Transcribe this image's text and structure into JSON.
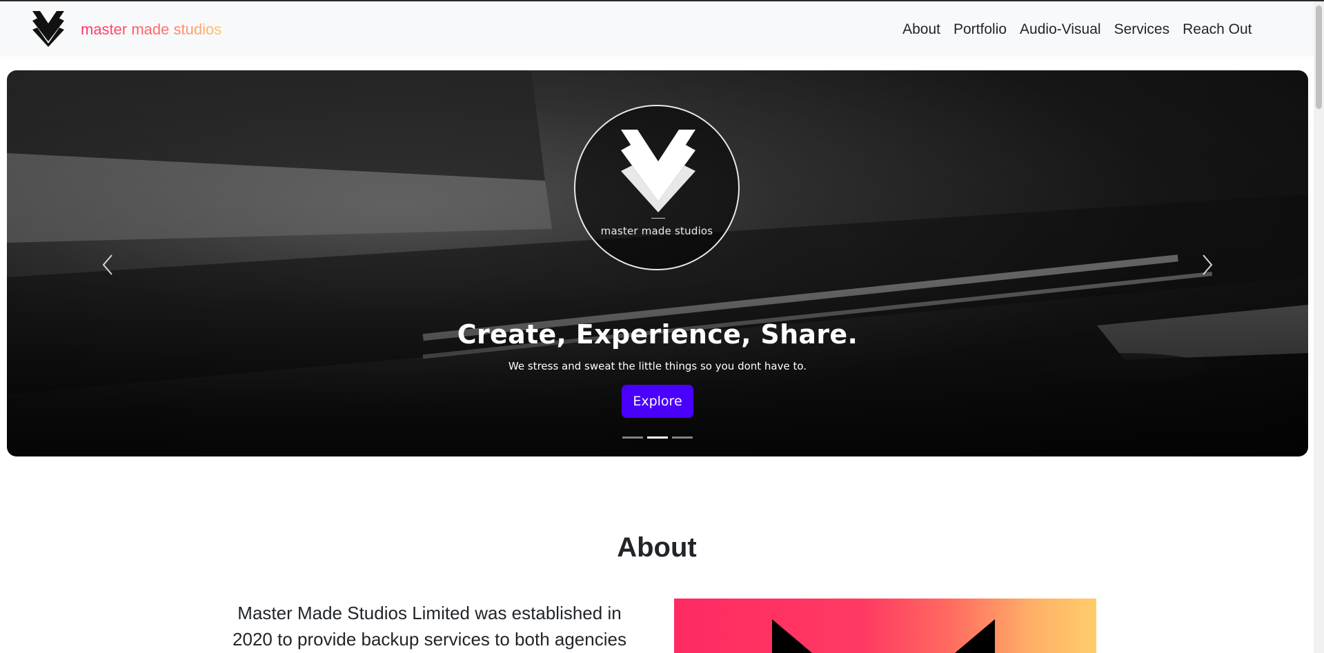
{
  "brand": {
    "name": "master made studios"
  },
  "nav": {
    "items": [
      "About",
      "Portfolio",
      "Audio-Visual",
      "Services",
      "Reach Out"
    ]
  },
  "hero": {
    "emblem_text": "master made studios",
    "headline": "Create, Experience, Share.",
    "subtext": "We stress and sweat the little things so you dont have to.",
    "cta_label": "Explore",
    "slides_total": 3,
    "active_slide": 2
  },
  "about": {
    "title": "About",
    "text": "Master Made Studios Limited was established in 2020 to provide backup services to both agencies"
  },
  "colors": {
    "accent": "#4a00ff",
    "gradient_start": "#ff2d6a",
    "gradient_end": "#ffc56a",
    "navbar_bg": "#f8f9fa"
  }
}
